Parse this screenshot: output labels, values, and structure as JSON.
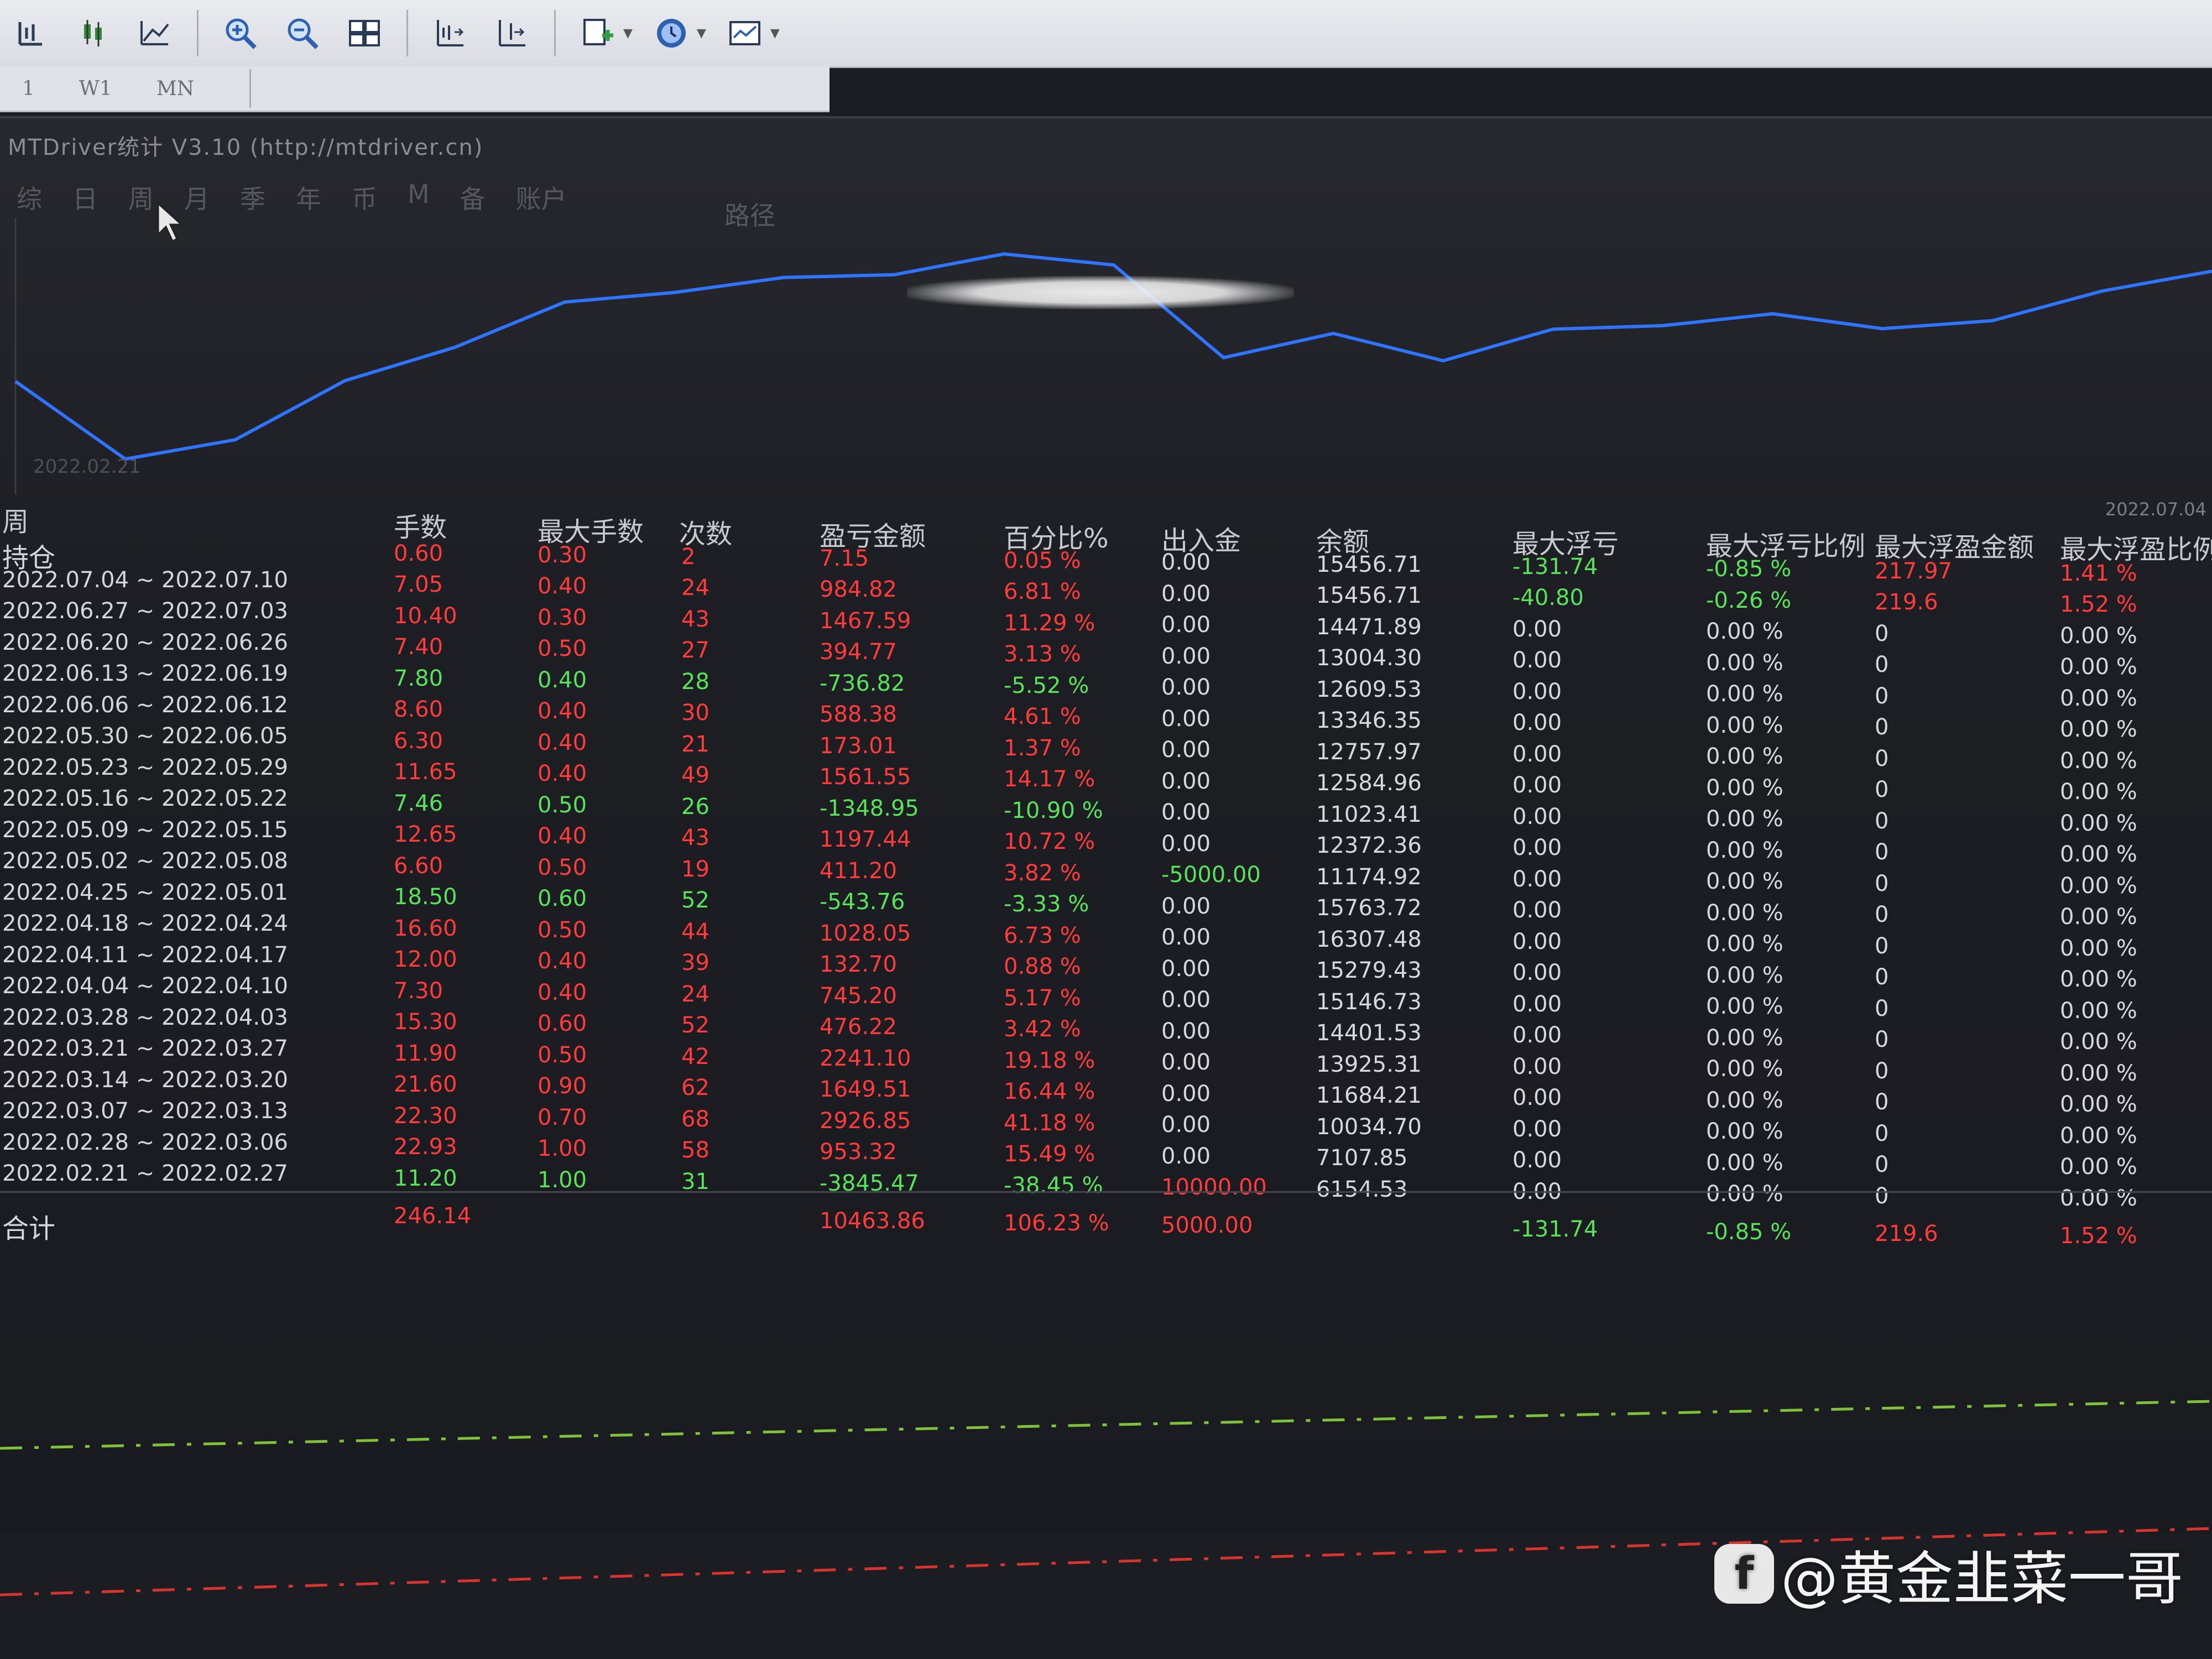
{
  "toolbar": {
    "buttons": [
      {
        "icon": "bar-chart-icon"
      },
      {
        "icon": "candlestick-icon"
      },
      {
        "icon": "line-chart-icon"
      },
      {
        "icon": "zoom-in-icon"
      },
      {
        "icon": "zoom-out-icon"
      },
      {
        "icon": "tile-windows-icon"
      },
      {
        "icon": "chart-shift-icon"
      },
      {
        "icon": "autoscroll-icon"
      },
      {
        "icon": "add-indicator-icon"
      },
      {
        "icon": "period-clock-icon"
      },
      {
        "icon": "templates-icon"
      }
    ],
    "timeframes": [
      "1",
      "W1",
      "MN"
    ]
  },
  "window": {
    "title": "MTDriver统计 V3.10 (http://mtdriver.cn)",
    "tabs": [
      "综",
      "日",
      "周",
      "月",
      "季",
      "年",
      "币",
      "M",
      "备",
      "账户"
    ],
    "path_tab": "路径",
    "chart_start_date": "2022.02.21",
    "chart_end_date": "2022.07.04"
  },
  "table": {
    "headers": {
      "period": "周",
      "lots": "手数",
      "max_lots": "最大手数",
      "count": "次数",
      "pnl": "盈亏金额",
      "pct": "百分比%",
      "deposit": "出入金",
      "balance": "余额",
      "max_dd": "最大浮亏",
      "max_dd_pct": "最大浮亏比例",
      "max_fp": "最大浮盈金额",
      "max_fp_pct": "最大浮盈比例"
    },
    "rows": [
      {
        "period": "持仓",
        "lots": "0.60",
        "max_lots": "0.30",
        "count": "2",
        "pnl": "7.15",
        "pct": "0.05 %",
        "deposit": "0.00",
        "balance": "15456.71",
        "max_dd": "-131.74",
        "max_dd_pct": "-0.85 %",
        "max_fp": "217.97",
        "max_fp_pct": "1.41 %",
        "pos": true
      },
      {
        "period": "2022.07.04 ~ 2022.07.10",
        "lots": "7.05",
        "max_lots": "0.40",
        "count": "24",
        "pnl": "984.82",
        "pct": "6.81 %",
        "deposit": "0.00",
        "balance": "15456.71",
        "max_dd": "-40.80",
        "max_dd_pct": "-0.26 %",
        "max_fp": "219.6",
        "max_fp_pct": "1.52 %",
        "pos": true
      },
      {
        "period": "2022.06.27 ~ 2022.07.03",
        "lots": "10.40",
        "max_lots": "0.30",
        "count": "43",
        "pnl": "1467.59",
        "pct": "11.29 %",
        "deposit": "0.00",
        "balance": "14471.89",
        "max_dd": "0.00",
        "max_dd_pct": "0.00 %",
        "max_fp": "0",
        "max_fp_pct": "0.00 %",
        "pos": true
      },
      {
        "period": "2022.06.20 ~ 2022.06.26",
        "lots": "7.40",
        "max_lots": "0.50",
        "count": "27",
        "pnl": "394.77",
        "pct": "3.13 %",
        "deposit": "0.00",
        "balance": "13004.30",
        "max_dd": "0.00",
        "max_dd_pct": "0.00 %",
        "max_fp": "0",
        "max_fp_pct": "0.00 %",
        "pos": true
      },
      {
        "period": "2022.06.13 ~ 2022.06.19",
        "lots": "7.80",
        "max_lots": "0.40",
        "count": "28",
        "pnl": "-736.82",
        "pct": "-5.52 %",
        "deposit": "0.00",
        "balance": "12609.53",
        "max_dd": "0.00",
        "max_dd_pct": "0.00 %",
        "max_fp": "0",
        "max_fp_pct": "0.00 %",
        "pos": false
      },
      {
        "period": "2022.06.06 ~ 2022.06.12",
        "lots": "8.60",
        "max_lots": "0.40",
        "count": "30",
        "pnl": "588.38",
        "pct": "4.61 %",
        "deposit": "0.00",
        "balance": "13346.35",
        "max_dd": "0.00",
        "max_dd_pct": "0.00 %",
        "max_fp": "0",
        "max_fp_pct": "0.00 %",
        "pos": true
      },
      {
        "period": "2022.05.30 ~ 2022.06.05",
        "lots": "6.30",
        "max_lots": "0.40",
        "count": "21",
        "pnl": "173.01",
        "pct": "1.37 %",
        "deposit": "0.00",
        "balance": "12757.97",
        "max_dd": "0.00",
        "max_dd_pct": "0.00 %",
        "max_fp": "0",
        "max_fp_pct": "0.00 %",
        "pos": true
      },
      {
        "period": "2022.05.23 ~ 2022.05.29",
        "lots": "11.65",
        "max_lots": "0.40",
        "count": "49",
        "pnl": "1561.55",
        "pct": "14.17 %",
        "deposit": "0.00",
        "balance": "12584.96",
        "max_dd": "0.00",
        "max_dd_pct": "0.00 %",
        "max_fp": "0",
        "max_fp_pct": "0.00 %",
        "pos": true
      },
      {
        "period": "2022.05.16 ~ 2022.05.22",
        "lots": "7.46",
        "max_lots": "0.50",
        "count": "26",
        "pnl": "-1348.95",
        "pct": "-10.90 %",
        "deposit": "0.00",
        "balance": "11023.41",
        "max_dd": "0.00",
        "max_dd_pct": "0.00 %",
        "max_fp": "0",
        "max_fp_pct": "0.00 %",
        "pos": false
      },
      {
        "period": "2022.05.09 ~ 2022.05.15",
        "lots": "12.65",
        "max_lots": "0.40",
        "count": "43",
        "pnl": "1197.44",
        "pct": "10.72 %",
        "deposit": "0.00",
        "balance": "12372.36",
        "max_dd": "0.00",
        "max_dd_pct": "0.00 %",
        "max_fp": "0",
        "max_fp_pct": "0.00 %",
        "pos": true
      },
      {
        "period": "2022.05.02 ~ 2022.05.08",
        "lots": "6.60",
        "max_lots": "0.50",
        "count": "19",
        "pnl": "411.20",
        "pct": "3.82 %",
        "deposit": "-5000.00",
        "balance": "11174.92",
        "max_dd": "0.00",
        "max_dd_pct": "0.00 %",
        "max_fp": "0",
        "max_fp_pct": "0.00 %",
        "pos": true,
        "dep_neg": true
      },
      {
        "period": "2022.04.25 ~ 2022.05.01",
        "lots": "18.50",
        "max_lots": "0.60",
        "count": "52",
        "pnl": "-543.76",
        "pct": "-3.33 %",
        "deposit": "0.00",
        "balance": "15763.72",
        "max_dd": "0.00",
        "max_dd_pct": "0.00 %",
        "max_fp": "0",
        "max_fp_pct": "0.00 %",
        "pos": false
      },
      {
        "period": "2022.04.18 ~ 2022.04.24",
        "lots": "16.60",
        "max_lots": "0.50",
        "count": "44",
        "pnl": "1028.05",
        "pct": "6.73 %",
        "deposit": "0.00",
        "balance": "16307.48",
        "max_dd": "0.00",
        "max_dd_pct": "0.00 %",
        "max_fp": "0",
        "max_fp_pct": "0.00 %",
        "pos": true
      },
      {
        "period": "2022.04.11 ~ 2022.04.17",
        "lots": "12.00",
        "max_lots": "0.40",
        "count": "39",
        "pnl": "132.70",
        "pct": "0.88 %",
        "deposit": "0.00",
        "balance": "15279.43",
        "max_dd": "0.00",
        "max_dd_pct": "0.00 %",
        "max_fp": "0",
        "max_fp_pct": "0.00 %",
        "pos": true
      },
      {
        "period": "2022.04.04 ~ 2022.04.10",
        "lots": "7.30",
        "max_lots": "0.40",
        "count": "24",
        "pnl": "745.20",
        "pct": "5.17 %",
        "deposit": "0.00",
        "balance": "15146.73",
        "max_dd": "0.00",
        "max_dd_pct": "0.00 %",
        "max_fp": "0",
        "max_fp_pct": "0.00 %",
        "pos": true
      },
      {
        "period": "2022.03.28 ~ 2022.04.03",
        "lots": "15.30",
        "max_lots": "0.60",
        "count": "52",
        "pnl": "476.22",
        "pct": "3.42 %",
        "deposit": "0.00",
        "balance": "14401.53",
        "max_dd": "0.00",
        "max_dd_pct": "0.00 %",
        "max_fp": "0",
        "max_fp_pct": "0.00 %",
        "pos": true
      },
      {
        "period": "2022.03.21 ~ 2022.03.27",
        "lots": "11.90",
        "max_lots": "0.50",
        "count": "42",
        "pnl": "2241.10",
        "pct": "19.18 %",
        "deposit": "0.00",
        "balance": "13925.31",
        "max_dd": "0.00",
        "max_dd_pct": "0.00 %",
        "max_fp": "0",
        "max_fp_pct": "0.00 %",
        "pos": true
      },
      {
        "period": "2022.03.14 ~ 2022.03.20",
        "lots": "21.60",
        "max_lots": "0.90",
        "count": "62",
        "pnl": "1649.51",
        "pct": "16.44 %",
        "deposit": "0.00",
        "balance": "11684.21",
        "max_dd": "0.00",
        "max_dd_pct": "0.00 %",
        "max_fp": "0",
        "max_fp_pct": "0.00 %",
        "pos": true
      },
      {
        "period": "2022.03.07 ~ 2022.03.13",
        "lots": "22.30",
        "max_lots": "0.70",
        "count": "68",
        "pnl": "2926.85",
        "pct": "41.18 %",
        "deposit": "0.00",
        "balance": "10034.70",
        "max_dd": "0.00",
        "max_dd_pct": "0.00 %",
        "max_fp": "0",
        "max_fp_pct": "0.00 %",
        "pos": true
      },
      {
        "period": "2022.02.28 ~ 2022.03.06",
        "lots": "22.93",
        "max_lots": "1.00",
        "count": "58",
        "pnl": "953.32",
        "pct": "15.49 %",
        "deposit": "0.00",
        "balance": "7107.85",
        "max_dd": "0.00",
        "max_dd_pct": "0.00 %",
        "max_fp": "0",
        "max_fp_pct": "0.00 %",
        "pos": true
      },
      {
        "period": "2022.02.21 ~ 2022.02.27",
        "lots": "11.20",
        "max_lots": "1.00",
        "count": "31",
        "pnl": "-3845.47",
        "pct": "-38.45 %",
        "deposit": "10000.00",
        "balance": "6154.53",
        "max_dd": "0.00",
        "max_dd_pct": "0.00 %",
        "max_fp": "0",
        "max_fp_pct": "0.00 %",
        "pos": false,
        "dep_pos": true
      }
    ],
    "total": {
      "label": "合计",
      "lots": "246.14",
      "pnl": "10463.86",
      "pct": "106.23 %",
      "deposit": "5000.00",
      "max_dd": "-131.74",
      "max_dd_pct": "-0.85 %",
      "max_fp": "219.6",
      "max_fp_pct": "1.52 %"
    }
  },
  "colors": {
    "profit": "#ff3b3b",
    "loss": "#59e35b",
    "equity_line": "#2f74ff",
    "neutral": "#d6d8de"
  },
  "watermark": {
    "text": "@黄金韭菜一哥",
    "logo_letter": "f"
  }
}
